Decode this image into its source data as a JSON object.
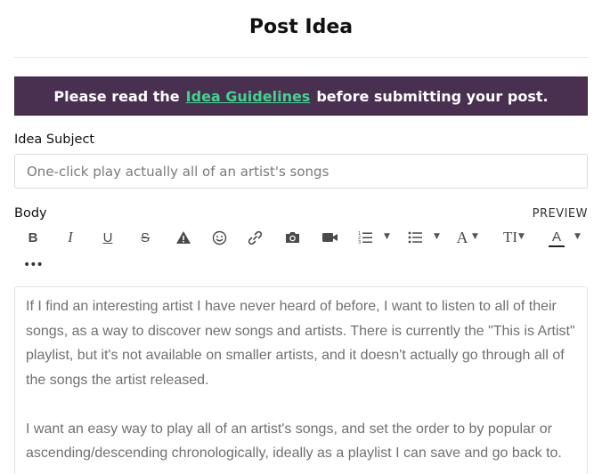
{
  "page": {
    "title": "Post Idea"
  },
  "banner": {
    "pre": "Please read the",
    "link": "Idea Guidelines",
    "post": "before submitting your post."
  },
  "subject": {
    "label": "Idea Subject",
    "placeholder": "One-click play actually all of an artist's songs"
  },
  "body": {
    "label": "Body",
    "preview_label": "PREVIEW",
    "paragraphs": [
      "If I find an interesting artist I have never heard of before, I want to listen to all of their songs, as a way to discover new songs and artists. There is currently the \"This is Artist\" playlist, but it's not available on smaller artists, and it doesn't actually go through all of the songs the artist released.",
      "I want an easy way to play all of an artist's songs, and set the order to by popular or ascending/descending chronologically, ideally as a playlist I can save and go back to."
    ]
  },
  "toolbar": {
    "bold": "B",
    "italic": "I",
    "underline": "U",
    "strike": "S",
    "font": "A",
    "text_size": "TI",
    "text_color": "A",
    "more": "•••"
  },
  "colors": {
    "banner_bg": "#4a3050",
    "link": "#3dd68c"
  }
}
